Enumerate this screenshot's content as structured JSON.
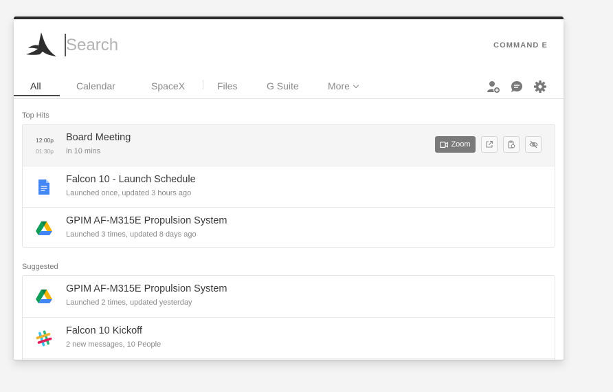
{
  "search": {
    "placeholder": "Search",
    "value": "",
    "shortcut": "COMMAND E"
  },
  "tabs": [
    {
      "label": "All",
      "active": true
    },
    {
      "label": "Calendar"
    },
    {
      "label": "SpaceX"
    },
    {
      "label": "Files"
    },
    {
      "label": "G Suite"
    },
    {
      "label": "More"
    }
  ],
  "toolbar_icons": [
    "add-user-icon",
    "chat-icon",
    "gear-icon"
  ],
  "sections": {
    "top_hits": {
      "label": "Top Hits",
      "items": [
        {
          "icon": "calendar-time",
          "time_start": "12:00p",
          "time_end": "01:30p",
          "title": "Board Meeting",
          "subtitle": "in 10 mins",
          "actions": {
            "zoom_label": "Zoom"
          }
        },
        {
          "icon": "google-docs-icon",
          "title": "Falcon 10 - Launch Schedule",
          "subtitle": "Launched once, updated 3 hours ago"
        },
        {
          "icon": "google-drive-icon",
          "title": "GPIM AF-M315E Propulsion System",
          "subtitle": "Launched 3 times, updated 8 days ago"
        }
      ]
    },
    "suggested": {
      "label": "Suggested",
      "items": [
        {
          "icon": "google-drive-icon",
          "title": "GPIM AF-M315E Propulsion System",
          "subtitle": "Launched 2 times, updated yesterday"
        },
        {
          "icon": "slack-icon",
          "title": "Falcon 10 Kickoff",
          "subtitle": "2 new messages, 10 People"
        }
      ]
    }
  },
  "colors": {
    "accent_dark": "#2b2b2b",
    "zoom_button": "#7a7a7a",
    "docs_blue": "#4285f4",
    "drive_green": "#0f9d58",
    "drive_yellow": "#f4b400",
    "drive_blue": "#4285f4"
  }
}
